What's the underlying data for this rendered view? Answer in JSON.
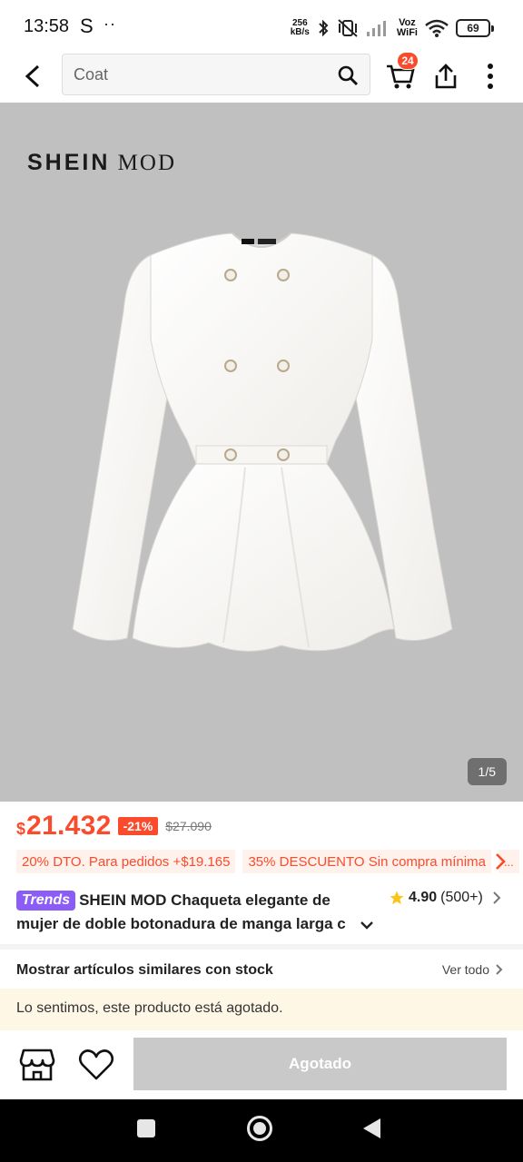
{
  "status_bar": {
    "time": "13:58",
    "app_indicator": "S",
    "dots": "··",
    "net_speed_value": "256",
    "net_speed_unit": "kB/s",
    "voz": "Voz",
    "wifi_label": "WiFi",
    "battery": "69"
  },
  "header": {
    "search_value": "Coat",
    "cart_count": "24"
  },
  "gallery": {
    "brand_primary": "SHEIN",
    "brand_secondary": "MOD",
    "counter": "1/5"
  },
  "price": {
    "currency": "$",
    "value": "21.432",
    "discount": "-21%",
    "original": "$27.090"
  },
  "promos": {
    "items": [
      "20% DTO. Para pedidos +$19.165",
      "35% DESCUENTO Sin compra mínima"
    ],
    "more": "..."
  },
  "product": {
    "badge": "Trends",
    "title_line1": "SHEIN MOD Chaqueta elegante de",
    "title_line2": "mujer de doble botonadura de manga larga c",
    "rating": "4.90",
    "reviews": "(500+)"
  },
  "similar": {
    "title": "Mostrar artículos similares con stock",
    "see_all": "Ver todo"
  },
  "notice": {
    "text": "Lo sentimos, este producto está agotado."
  },
  "bottom_bar": {
    "sold_out_label": "Agotado"
  },
  "colors": {
    "accent": "#fa4b2c",
    "trends": "#8b5cf6",
    "image_bg": "#c0c0c0",
    "disabled": "#c9c9c9"
  },
  "icons": [
    "back-arrow-icon",
    "search-icon",
    "cart-icon",
    "share-icon",
    "more-icon",
    "star-icon",
    "chevron-right-icon",
    "chevron-down-icon",
    "store-icon",
    "heart-icon"
  ]
}
